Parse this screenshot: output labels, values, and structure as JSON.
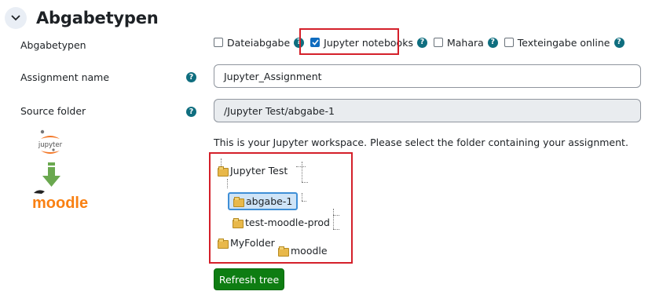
{
  "section": {
    "title": "Abgabetypen",
    "collapse_icon": "chevron-down-icon"
  },
  "fields": {
    "types_label": "Abgabetypen",
    "name_label": "Assignment name",
    "folder_label": "Source folder"
  },
  "submission_types": [
    {
      "label": "Dateiabgabe",
      "checked": false
    },
    {
      "label": "Jupyter notebooks",
      "checked": true
    },
    {
      "label": "Mahara",
      "checked": false
    },
    {
      "label": "Texteingabe online",
      "checked": false
    }
  ],
  "assignment_name": {
    "value": "Jupyter_Assignment"
  },
  "source_folder": {
    "value": "/Jupyter Test/abgabe-1"
  },
  "logos": {
    "top": "jupyter",
    "bottom": "moodle"
  },
  "workspace_hint": "This is your Jupyter workspace. Please select the folder containing your assignment.",
  "tree": {
    "nodes": [
      {
        "label": "Jupyter Test"
      },
      {
        "label": "abgabe-1",
        "selected": true
      },
      {
        "label": "test-moodle-prod"
      },
      {
        "label": "MyFolder"
      },
      {
        "label": "moodle"
      }
    ]
  },
  "refresh_button": "Refresh tree",
  "colors": {
    "accent": "#0f6cbf",
    "help": "#0f6e7f",
    "highlight": "#d4202a",
    "button": "#0e7d12"
  }
}
